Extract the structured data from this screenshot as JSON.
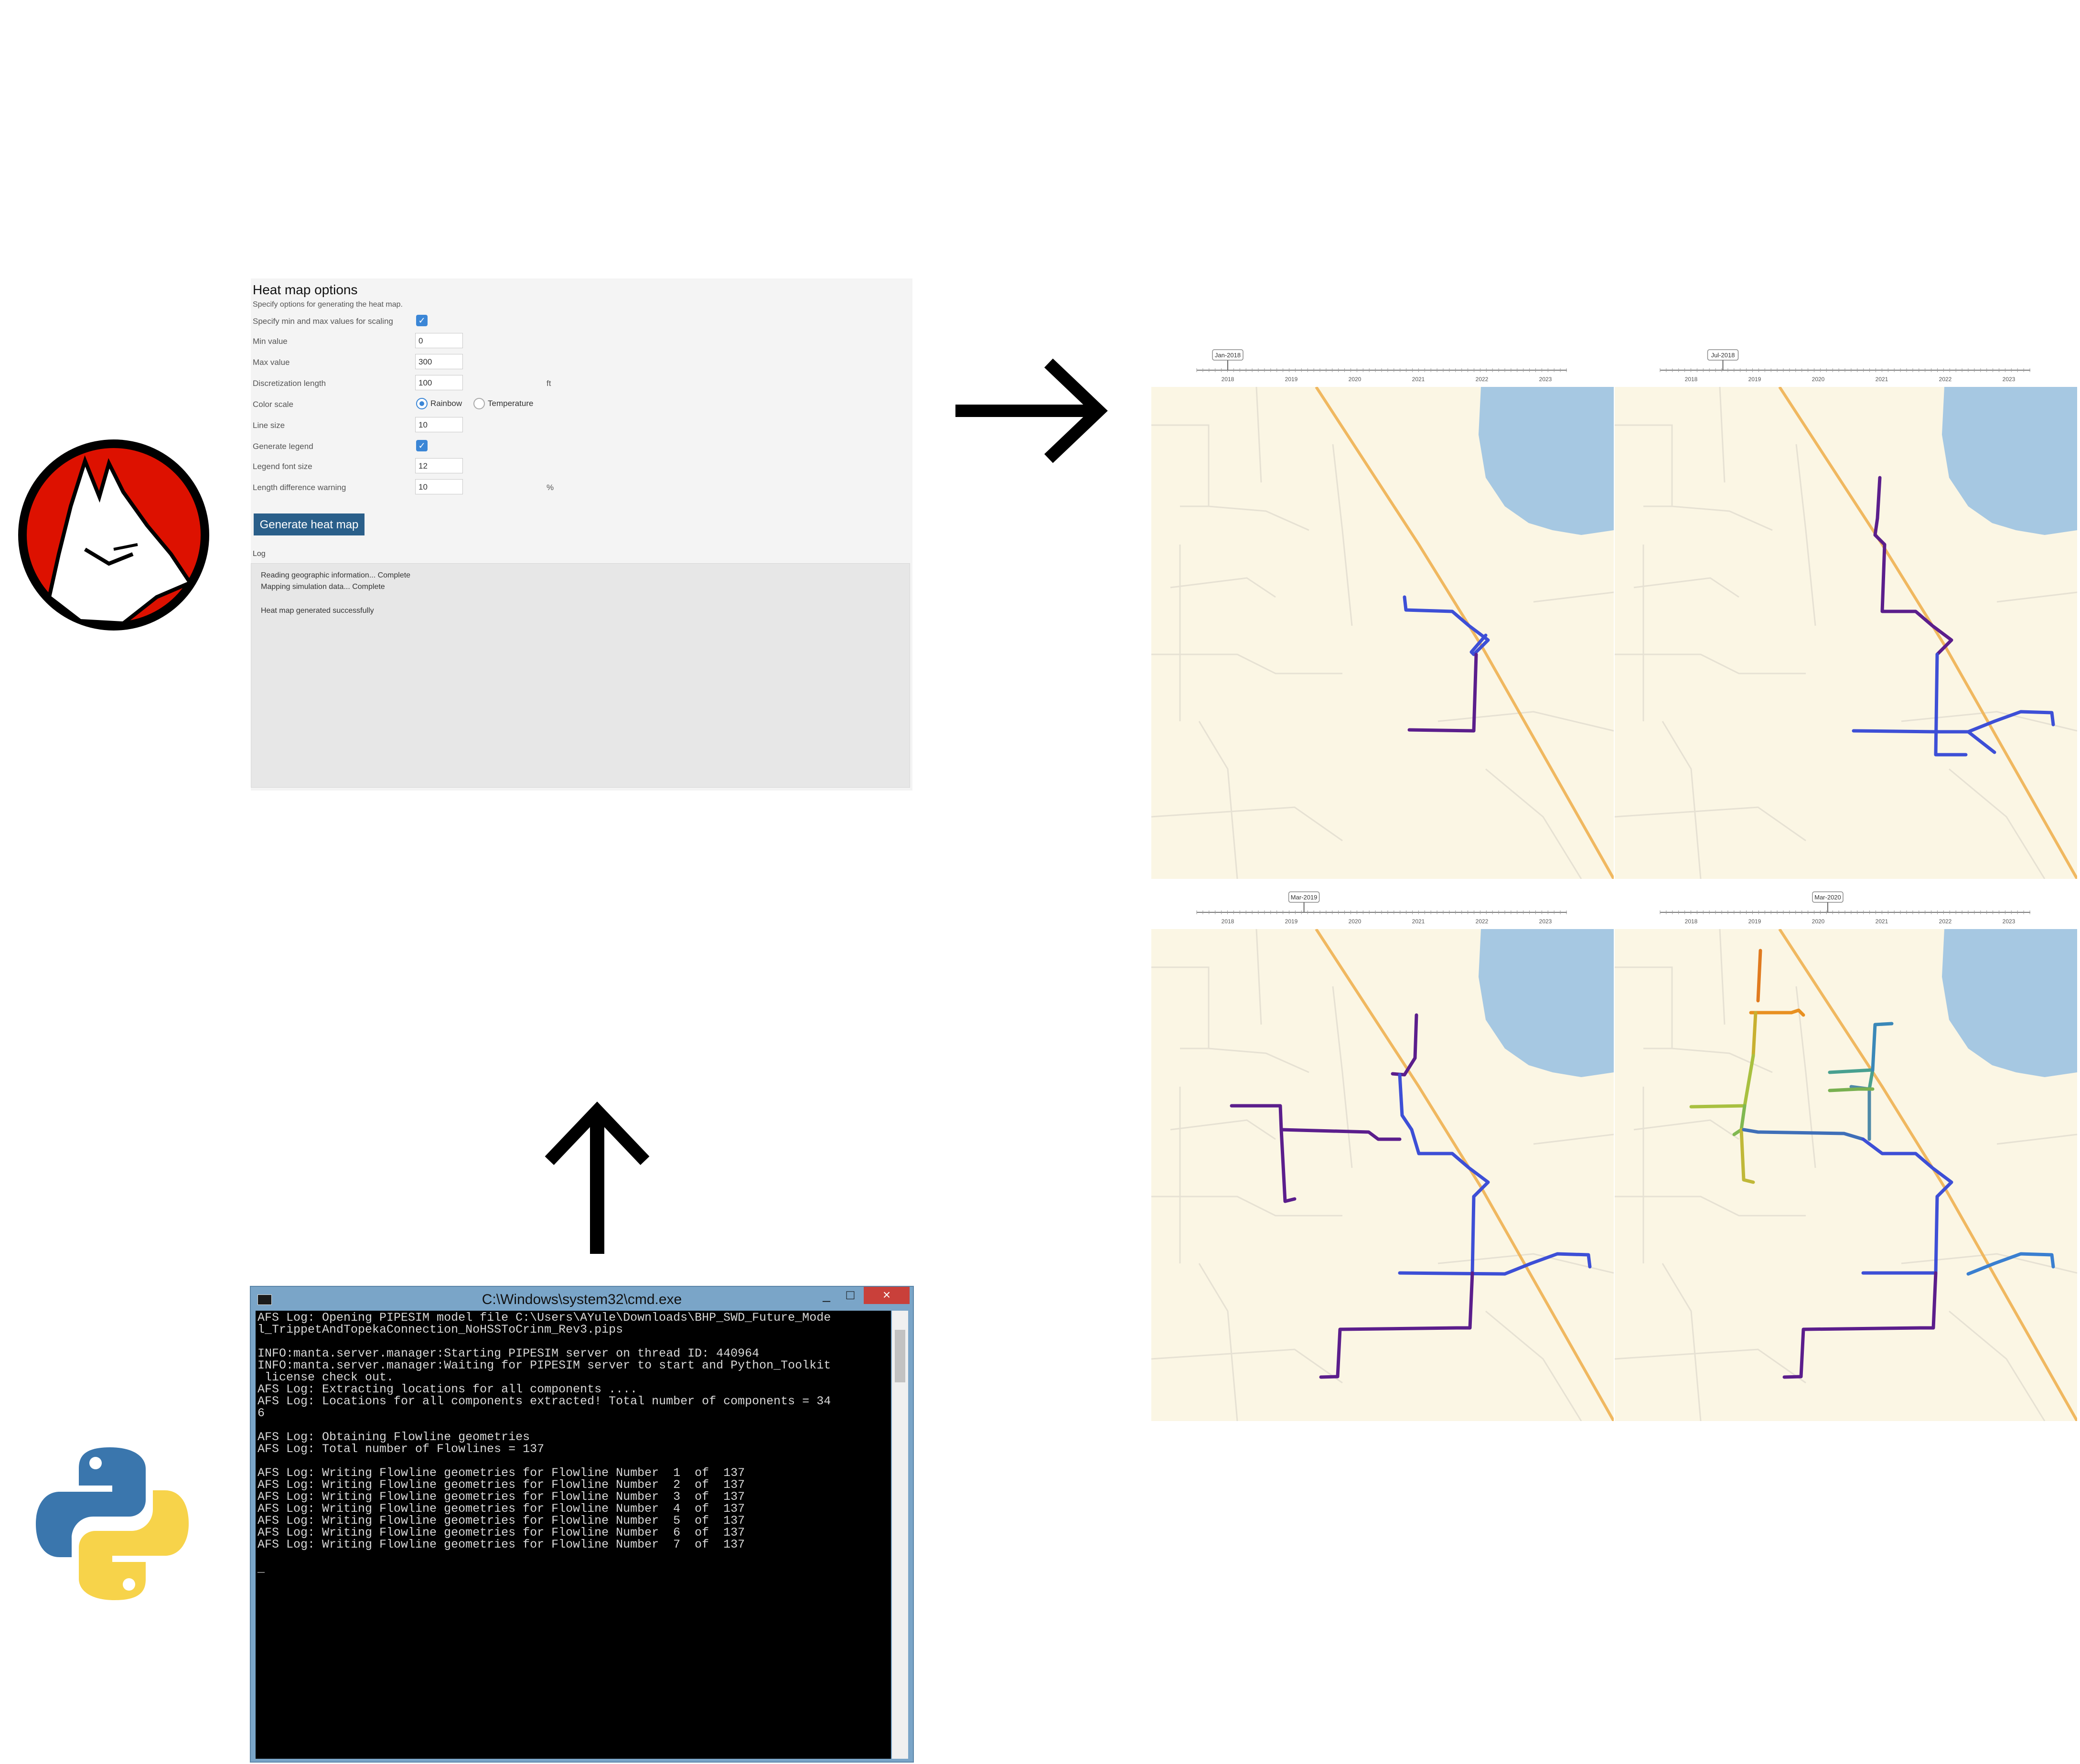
{
  "heatmap_options": {
    "title": "Heat map options",
    "subtitle": "Specify options for generating the heat map.",
    "specify_minmax_label": "Specify min and max values for scaling",
    "min_value_label": "Min value",
    "min_value": "0",
    "max_value_label": "Max value",
    "max_value": "300",
    "discretization_label": "Discretization length",
    "discretization_value": "100",
    "discretization_unit": "ft",
    "color_scale_label": "Color scale",
    "color_scale_options": [
      "Rainbow",
      "Temperature"
    ],
    "color_scale_selected": "Rainbow",
    "line_size_label": "Line size",
    "line_size_value": "10",
    "generate_legend_label": "Generate legend",
    "legend_font_label": "Legend font size",
    "legend_font_value": "12",
    "length_diff_label": "Length difference warning",
    "length_diff_value": "10",
    "length_diff_unit": "%",
    "generate_button": "Generate heat map",
    "log_label": "Log",
    "log_lines": [
      "Reading geographic information... Complete",
      "Mapping simulation data... Complete",
      "",
      "Heat map generated successfully"
    ]
  },
  "maps": {
    "years": [
      "2018",
      "2019",
      "2020",
      "2021",
      "2022",
      "2023"
    ],
    "panels": [
      {
        "date_label": "Jan-2018",
        "slider_fraction": 0.0
      },
      {
        "date_label": "Jul-2018",
        "slider_fraction": 0.1
      },
      {
        "date_label": "Mar-2019",
        "slider_fraction": 0.24
      },
      {
        "date_label": "Mar-2020",
        "slider_fraction": 0.43
      }
    ],
    "colors": {
      "land": "#fbf6e4",
      "water": "#a6c8e2",
      "highway": "#f0b860",
      "road": "#e6e1d3",
      "pipe_low": "#5b1e8c",
      "pipe_mid": "#3d4fd6",
      "pipe_high": "#e07a1f"
    }
  },
  "console": {
    "title": "C:\\Windows\\system32\\cmd.exe",
    "minimize": "_",
    "maximize": "□",
    "close": "×",
    "lines": [
      "AFS Log: Opening PIPESIM model file C:\\Users\\AYule\\Downloads\\BHP_SWD_Future_Mode",
      "l_TrippetAndTopekaConnection_NoHSSToCrinm_Rev3.pips",
      "",
      "INFO:manta.server.manager:Starting PIPESIM server on thread ID: 440964",
      "INFO:manta.server.manager:Waiting for PIPESIM server to start and Python_Toolkit",
      " license check out.",
      "AFS Log: Extracting locations for all components ....",
      "AFS Log: Locations for all components extracted! Total number of components = 34",
      "6",
      "",
      "AFS Log: Obtaining Flowline geometries",
      "AFS Log: Total number of Flowlines = 137",
      "",
      "AFS Log: Writing Flowline geometries for Flowline Number  1  of  137",
      "AFS Log: Writing Flowline geometries for Flowline Number  2  of  137",
      "AFS Log: Writing Flowline geometries for Flowline Number  3  of  137",
      "AFS Log: Writing Flowline geometries for Flowline Number  4  of  137",
      "AFS Log: Writing Flowline geometries for Flowline Number  5  of  137",
      "AFS Log: Writing Flowline geometries for Flowline Number  6  of  137",
      "AFS Log: Writing Flowline geometries for Flowline Number  7  of  137",
      "",
      "_"
    ]
  }
}
